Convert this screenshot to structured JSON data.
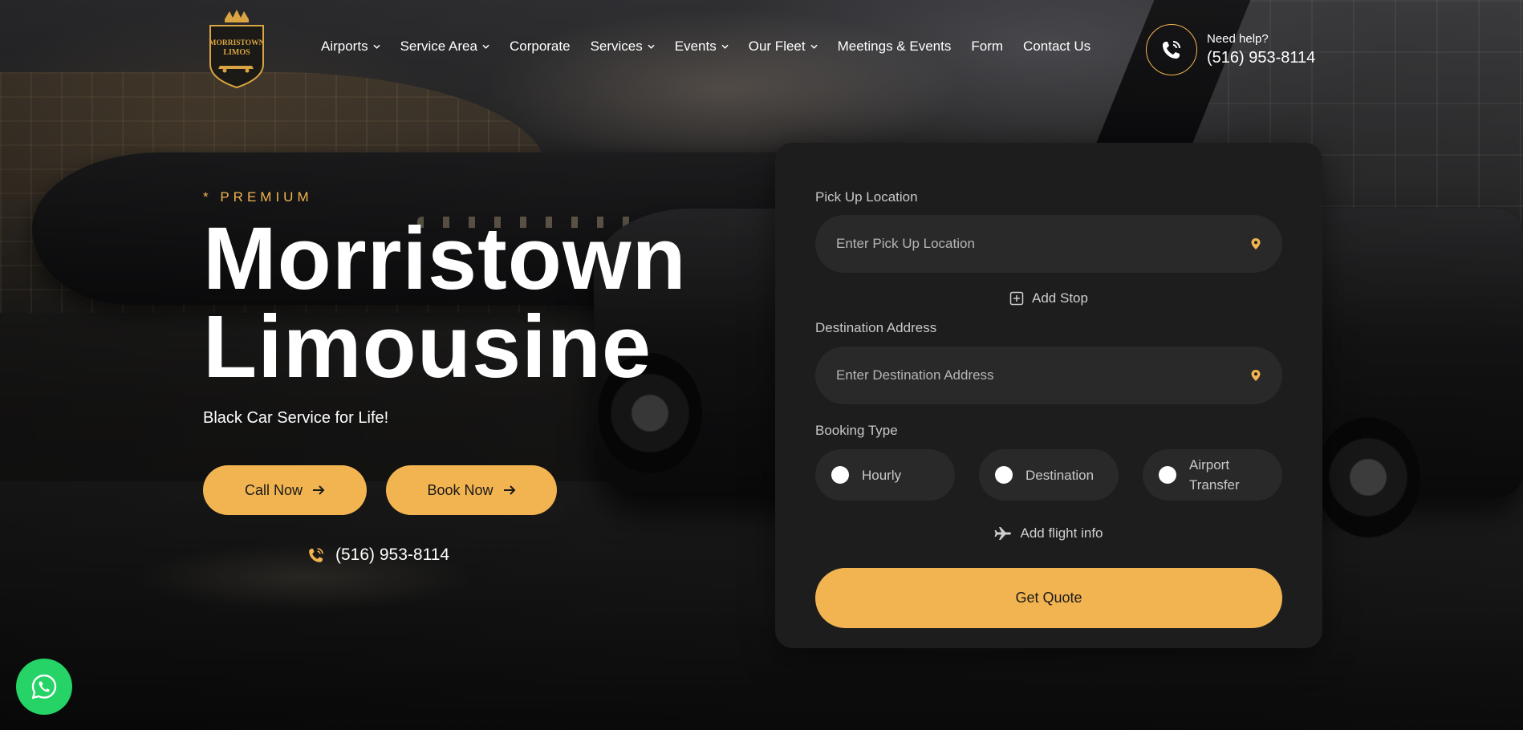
{
  "brand": {
    "logo_line1": "MORRISTOWN",
    "logo_line2": "LIMOS",
    "accent_color": "#f2b450",
    "icon": "crown-shield-logo"
  },
  "nav": {
    "items": [
      {
        "label": "Airports",
        "has_dropdown": true
      },
      {
        "label": "Service Area",
        "has_dropdown": true
      },
      {
        "label": "Corporate",
        "has_dropdown": false
      },
      {
        "label": "Services",
        "has_dropdown": true
      },
      {
        "label": "Events",
        "has_dropdown": true
      },
      {
        "label": "Our Fleet",
        "has_dropdown": true
      },
      {
        "label": "Meetings & Events",
        "has_dropdown": false
      },
      {
        "label": "Form",
        "has_dropdown": false
      },
      {
        "label": "Contact Us",
        "has_dropdown": false
      }
    ]
  },
  "help": {
    "label": "Need help?",
    "phone": "(516) 953-8114",
    "icon": "phone-ring-icon"
  },
  "hero": {
    "eyebrow": "* PREMIUM",
    "title_line1": "Morristown",
    "title_line2": "Limousine",
    "subtitle": "Black Car Service for Life!",
    "call_label": "Call Now",
    "book_label": "Book Now",
    "phone": "(516) 953-8114"
  },
  "booking": {
    "pickup_label": "Pick Up Location",
    "pickup_placeholder": "Enter Pick Up Location",
    "add_stop_label": "Add Stop",
    "destination_label": "Destination Address",
    "destination_placeholder": "Enter Destination Address",
    "booking_type_label": "Booking Type",
    "booking_types": [
      {
        "label_lines": [
          "Hourly"
        ]
      },
      {
        "label_lines": [
          "Destination"
        ]
      },
      {
        "label_lines": [
          "Airport",
          "Transfer"
        ]
      }
    ],
    "flight_info_label": "Add flight info",
    "submit_label": "Get Quote"
  },
  "floating": {
    "whatsapp_color": "#25d366",
    "icon": "whatsapp-icon"
  }
}
